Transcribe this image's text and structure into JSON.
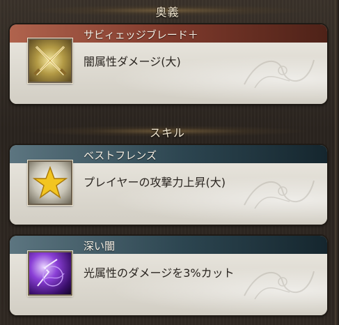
{
  "sections": {
    "ougi_title": "奥義",
    "skill_title": "スキル"
  },
  "ougi": {
    "name": "サビィェッジブレード＋",
    "description": "闇属性ダメージ(大)",
    "icon": "crossed-swords-icon"
  },
  "skills": [
    {
      "name": "ベストフレンズ",
      "description": "プレイヤーの攻撃力上昇(大)",
      "icon": "star-icon"
    },
    {
      "name": "深い闇",
      "description": "光属性のダメージを3%カット",
      "icon": "dark-orb-icon"
    }
  ],
  "colors": {
    "ougi_header": "#8a4332",
    "skill_header": "#2c4550",
    "card_body": "#dcd8cf",
    "background": "#2b2520"
  }
}
